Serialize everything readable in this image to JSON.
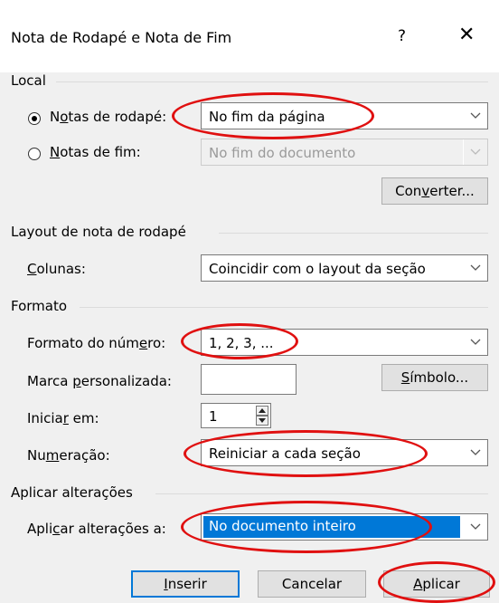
{
  "dialog": {
    "title": "Nota de Rodapé e Nota de Fim",
    "help": "?",
    "close": "✕"
  },
  "local": {
    "header": "Local",
    "footnotes": {
      "label_pre": "N",
      "label_u": "o",
      "label_post": "tas de rodapé:",
      "value": "No fim da página",
      "selected": true
    },
    "endnotes": {
      "label_pre": "",
      "label_u": "N",
      "label_post": "otas de fim:",
      "value": "No fim do documento",
      "selected": false
    },
    "convert": {
      "pre": "Con",
      "u": "v",
      "post": "erter..."
    }
  },
  "layout": {
    "header": "Layout de nota de rodapé",
    "columns_label": {
      "pre": "",
      "u": "C",
      "post": "olunas:"
    },
    "columns_value": "Coincidir com o layout da seção"
  },
  "format": {
    "header": "Formato",
    "number_format_label": {
      "pre": "Formato do núm",
      "u": "e",
      "post": "ro:"
    },
    "number_format_value": "1, 2, 3, ...",
    "custom_mark_label": {
      "pre": "Marca ",
      "u": "p",
      "post": "ersonalizada:"
    },
    "custom_mark_value": "",
    "symbol": {
      "pre": "",
      "u": "S",
      "post": "ímbolo..."
    },
    "start_at_label": {
      "pre": "Inicia",
      "u": "r",
      "post": " em:"
    },
    "start_at_value": "1",
    "numbering_label": {
      "pre": "Nu",
      "u": "m",
      "post": "eração:"
    },
    "numbering_value": "Reiniciar a cada seção"
  },
  "apply": {
    "header": "Aplicar alterações",
    "apply_to_label": {
      "pre": "Apli",
      "u": "c",
      "post": "ar alterações a:"
    },
    "apply_to_value": "No documento inteiro"
  },
  "buttons": {
    "insert": {
      "pre": "",
      "u": "I",
      "post": "nserir"
    },
    "cancel": "Cancelar",
    "apply": {
      "pre": "",
      "u": "A",
      "post": "plicar"
    }
  },
  "colors": {
    "accent": "#0078d7",
    "highlight": "#e01010",
    "selection": "#0078d7"
  }
}
